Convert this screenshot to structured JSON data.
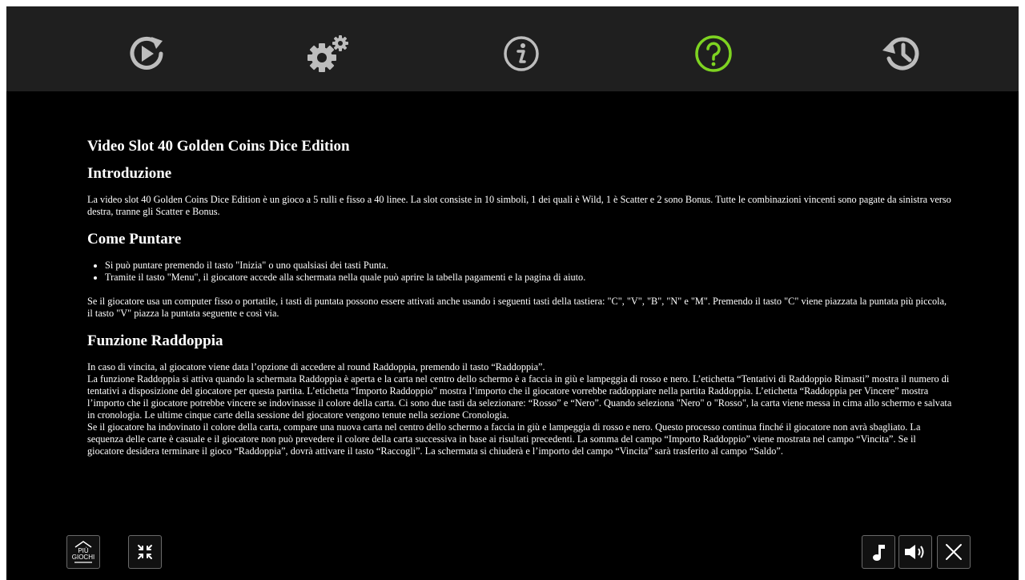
{
  "nav": {
    "items": [
      {
        "name": "autoplay",
        "icon": "replay-play-icon",
        "active": false
      },
      {
        "name": "settings",
        "icon": "gears-icon",
        "active": false
      },
      {
        "name": "info",
        "icon": "info-icon",
        "active": false
      },
      {
        "name": "help",
        "icon": "question-mark-icon",
        "active": true
      },
      {
        "name": "history",
        "icon": "history-clock-icon",
        "active": false
      }
    ],
    "colors": {
      "inactive": "#bdbdbd",
      "active": "#7ed321",
      "bar": "#1f1f1f"
    }
  },
  "help": {
    "title": "Video Slot 40 Golden Coins Dice Edition",
    "intro": {
      "heading": "Introduzione",
      "text": "La video slot 40 Golden Coins Dice Edition è un gioco a 5 rulli e fisso a 40 linee. La slot consiste in 10 simboli, 1 dei quali è Wild, 1 è Scatter e 2 sono Bonus. Tutte le combinazioni vincenti sono pagate da sinistra verso destra, tranne gli Scatter e Bonus."
    },
    "bet": {
      "heading": "Come Puntare",
      "bullets": [
        "Si può puntare premendo il tasto \"Inizia\" o uno qualsiasi dei tasti Punta.",
        "Tramite il tasto \"Menu\", il giocatore accede alla schermata nella quale può aprire la tabella pagamenti e la pagina di aiuto."
      ],
      "text": "Se il giocatore usa un computer fisso o portatile, i tasti di puntata possono essere attivati anche usando i seguenti tasti della tastiera: \"C\", \"V\", \"B\", \"N\" e \"M\". Premendo il tasto \"C\" viene piazzata la puntata più piccola, il tasto \"V\" piazza la puntata seguente e così via."
    },
    "double": {
      "heading": "Funzione Raddoppia",
      "paragraphs": [
        "In caso di vincita, al giocatore viene data l’opzione di accedere al round Raddoppia, premendo il tasto “Raddoppia”.",
        "La funzione Raddoppia si attiva quando la schermata Raddoppia è aperta e la carta nel centro dello schermo è a faccia in giù e lampeggia di rosso e nero. L’etichetta “Tentativi di Raddoppio Rimasti” mostra il numero di tentativi a disposizione del giocatore per questa partita. L’etichetta “Importo Raddoppio” mostra l’importo che il giocatore vorrebbe raddoppiare nella partita Raddoppia. L’etichetta “Raddoppia per Vincere” mostra l’importo che il giocatore potrebbe vincere se indovinasse il colore della carta. Ci sono due tasti da selezionare: “Rosso” e “Nero”. Quando seleziona \"Nero\" o \"Rosso\", la carta viene messa in cima allo schermo e salvata in cronologia. Le ultime cinque carte della sessione del giocatore vengono tenute nella sezione Cronologia.",
        "Se il giocatore ha indovinato il colore della carta, compare una nuova carta nel centro dello schermo a faccia in giù e lampeggia di rosso e nero. Questo processo continua finché il giocatore non avrà sbagliato. La sequenza delle carte è casuale e il giocatore non può prevedere il colore della carta successiva in base ai risultati precedenti. La somma del campo “Importo Raddoppio” viene mostrata nel campo “Vincita”. Se il giocatore desidera terminare il gioco “Raddoppia”, dovrà attivare il tasto “Raccogli”. La schermata si chiuderà e l’importo del campo “Vincita” sarà trasferito al campo “Saldo”."
      ]
    }
  },
  "bottom": {
    "more_games_line1": "PIÙ",
    "more_games_line2": "GIOCHI",
    "icons": [
      "home-icon",
      "fullscreen-exit-icon",
      "music-note-icon",
      "speaker-icon",
      "close-icon"
    ]
  }
}
